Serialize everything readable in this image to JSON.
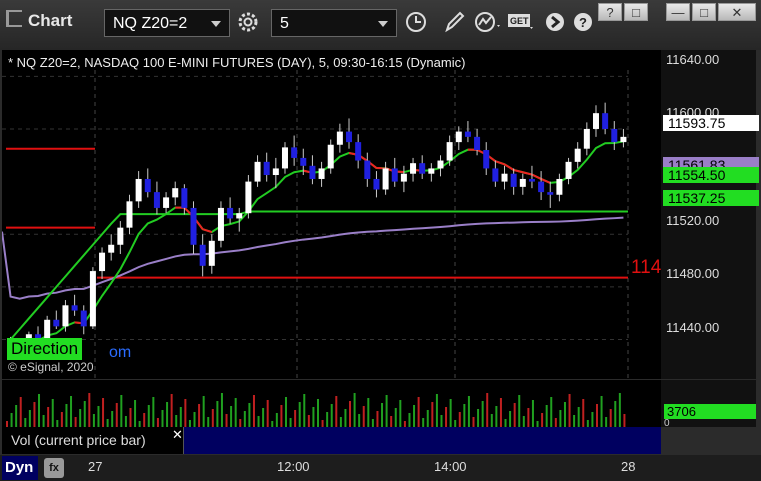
{
  "app": {
    "title": "Chart"
  },
  "toolbar": {
    "symbol": "NQ Z20=2",
    "interval": "5",
    "buttons": [
      "gear-icon",
      "clock-icon",
      "pen-icon",
      "study-icon",
      "get-icon",
      "arrow-icon",
      "help-icon"
    ]
  },
  "window_controls": [
    "?",
    "□",
    "—",
    "□",
    "✕"
  ],
  "chart": {
    "header": "* NQ Z20=2, NASDAQ 100 E-MINI FUTURES (DAY), 5, 09:30-16:15 (Dynamic)",
    "copyright": "© eSignal, 2020",
    "direction_label": "Direction",
    "partial_text": "om",
    "cut_price_text": "114",
    "price_ticks": [
      "11640.00",
      "11600.00",
      "11520.00",
      "11480.00",
      "11440.00"
    ],
    "price_tags": {
      "last": "11593.75",
      "vwap": "11561.83",
      "ma_fast": "11554.50",
      "ma_slow": "11537.25"
    },
    "time_ticks": [
      "27",
      "12:00",
      "14:00",
      "28"
    ],
    "dyn_label": "Dyn",
    "colors": {
      "up": "#ffffff",
      "down": "#2020e0",
      "ma_green": "#22cc22",
      "ma_red": "#ee2222",
      "vwap": "#9a7fc8",
      "level": "#e01010"
    }
  },
  "chart_data": {
    "type": "candlestick",
    "title": "* NQ Z20=2, NASDAQ 100 E-MINI FUTURES (DAY), 5, 09:30-16:15 (Dynamic)",
    "ylim": [
      11410,
      11660
    ],
    "x_ticks": [
      "27",
      "12:00",
      "14:00",
      "28"
    ],
    "levels": [
      11585,
      11525,
      11487
    ],
    "candles": [
      [
        11435,
        11442,
        11430,
        11438
      ],
      [
        11438,
        11440,
        11430,
        11432
      ],
      [
        11432,
        11446,
        11428,
        11444
      ],
      [
        11444,
        11450,
        11436,
        11441
      ],
      [
        11441,
        11458,
        11438,
        11455
      ],
      [
        11455,
        11462,
        11448,
        11450
      ],
      [
        11450,
        11470,
        11446,
        11466
      ],
      [
        11466,
        11474,
        11458,
        11462
      ],
      [
        11462,
        11466,
        11444,
        11450
      ],
      [
        11450,
        11495,
        11448,
        11492
      ],
      [
        11492,
        11510,
        11486,
        11506
      ],
      [
        11506,
        11520,
        11500,
        11512
      ],
      [
        11512,
        11530,
        11505,
        11525
      ],
      [
        11525,
        11550,
        11520,
        11545
      ],
      [
        11545,
        11568,
        11540,
        11562
      ],
      [
        11562,
        11570,
        11548,
        11552
      ],
      [
        11552,
        11560,
        11535,
        11540
      ],
      [
        11540,
        11552,
        11536,
        11548
      ],
      [
        11548,
        11560,
        11542,
        11555
      ],
      [
        11555,
        11558,
        11535,
        11540
      ],
      [
        11540,
        11545,
        11505,
        11512
      ],
      [
        11512,
        11520,
        11488,
        11496
      ],
      [
        11496,
        11520,
        11490,
        11515
      ],
      [
        11515,
        11545,
        11510,
        11540
      ],
      [
        11540,
        11548,
        11528,
        11532
      ],
      [
        11532,
        11540,
        11522,
        11536
      ],
      [
        11536,
        11565,
        11532,
        11560
      ],
      [
        11560,
        11580,
        11556,
        11575
      ],
      [
        11575,
        11582,
        11560,
        11565
      ],
      [
        11565,
        11578,
        11555,
        11570
      ],
      [
        11570,
        11590,
        11566,
        11586
      ],
      [
        11586,
        11595,
        11572,
        11578
      ],
      [
        11578,
        11585,
        11565,
        11572
      ],
      [
        11572,
        11580,
        11558,
        11562
      ],
      [
        11562,
        11575,
        11556,
        11570
      ],
      [
        11570,
        11592,
        11566,
        11588
      ],
      [
        11588,
        11604,
        11582,
        11598
      ],
      [
        11598,
        11608,
        11585,
        11590
      ],
      [
        11590,
        11596,
        11570,
        11576
      ],
      [
        11576,
        11582,
        11556,
        11562
      ],
      [
        11562,
        11568,
        11548,
        11554
      ],
      [
        11554,
        11575,
        11550,
        11570
      ],
      [
        11570,
        11578,
        11556,
        11560
      ],
      [
        11560,
        11572,
        11552,
        11566
      ],
      [
        11566,
        11578,
        11560,
        11574
      ],
      [
        11574,
        11580,
        11562,
        11566
      ],
      [
        11566,
        11574,
        11560,
        11570
      ],
      [
        11570,
        11580,
        11564,
        11576
      ],
      [
        11576,
        11595,
        11572,
        11590
      ],
      [
        11590,
        11602,
        11584,
        11598
      ],
      [
        11598,
        11606,
        11590,
        11594
      ],
      [
        11594,
        11600,
        11580,
        11584
      ],
      [
        11584,
        11590,
        11565,
        11570
      ],
      [
        11570,
        11576,
        11556,
        11560
      ],
      [
        11560,
        11572,
        11554,
        11566
      ],
      [
        11566,
        11570,
        11550,
        11556
      ],
      [
        11556,
        11566,
        11550,
        11562
      ],
      [
        11562,
        11572,
        11555,
        11560
      ],
      [
        11560,
        11568,
        11546,
        11552
      ],
      [
        11552,
        11560,
        11540,
        11550
      ],
      [
        11550,
        11566,
        11545,
        11562
      ],
      [
        11562,
        11578,
        11558,
        11575
      ],
      [
        11575,
        11590,
        11570,
        11585
      ],
      [
        11585,
        11605,
        11580,
        11600
      ],
      [
        11600,
        11618,
        11594,
        11612
      ],
      [
        11612,
        11620,
        11596,
        11600
      ],
      [
        11600,
        11606,
        11584,
        11590
      ],
      [
        11590,
        11600,
        11586,
        11594
      ]
    ],
    "volume_last": "3706",
    "volume_label": "Vol (current price bar)"
  }
}
